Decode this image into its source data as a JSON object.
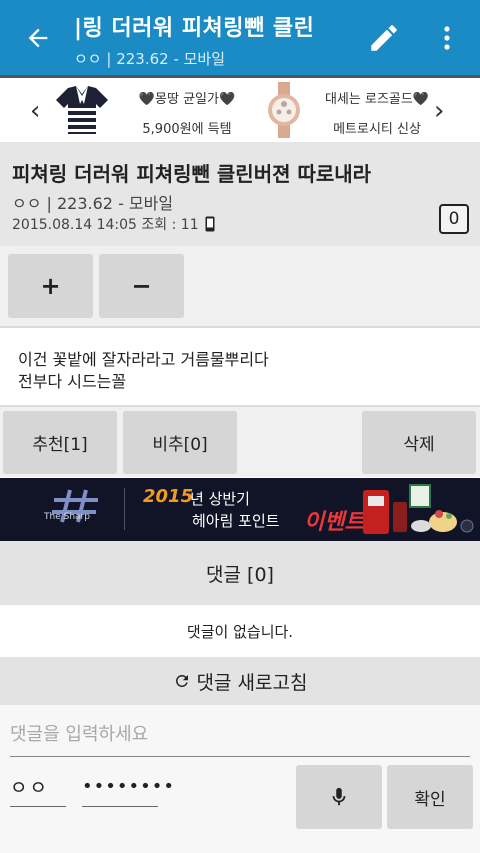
{
  "appbar": {
    "title": "|링 더러워 피쳐링뺀 클린",
    "subtitle": "ㅇㅇ | 223.62 - 모바일",
    "back_icon": "arrow-left-icon",
    "edit_icon": "pencil-icon",
    "more_icon": "more-vert-icon",
    "color": "#1b8bc6"
  },
  "ad": {
    "left_product": {
      "line1": "🖤몽땅 균일가🖤",
      "line2": "5,900원에 득템"
    },
    "right_product": {
      "line1": "대세는 로즈골드🖤",
      "line2": "메트로시티 신상"
    }
  },
  "post": {
    "title": "피쳐링 더러워 피쳐링뺀 클린버젼 따로내라",
    "author": "ㅇㅇ | 223.62 - 모바일",
    "meta": "2015.08.14 14:05 조회 : 11",
    "comment_count": "0",
    "body_line1": "이건 꽃밭에 잘자라라고 거름물뿌리다",
    "body_line2": "전부다 시드는꼴"
  },
  "vote": {
    "plus": "+",
    "minus": "−"
  },
  "actions": {
    "recommend": "추천[1]",
    "oppose": "비추[0]",
    "delete": "삭제"
  },
  "event_banner": {
    "brand": "The Sharp",
    "year": "2015",
    "half": "년 상반기",
    "point": "헤아림 포인트",
    "event": "이벤트!"
  },
  "comments": {
    "header": "댓글 [0]",
    "empty": "댓글이 없습니다.",
    "refresh": "댓글 새로고침"
  },
  "input": {
    "placeholder": "댓글을 입력하세요",
    "name": "ㅇㅇ",
    "password": "••••••••",
    "confirm": "확인"
  }
}
